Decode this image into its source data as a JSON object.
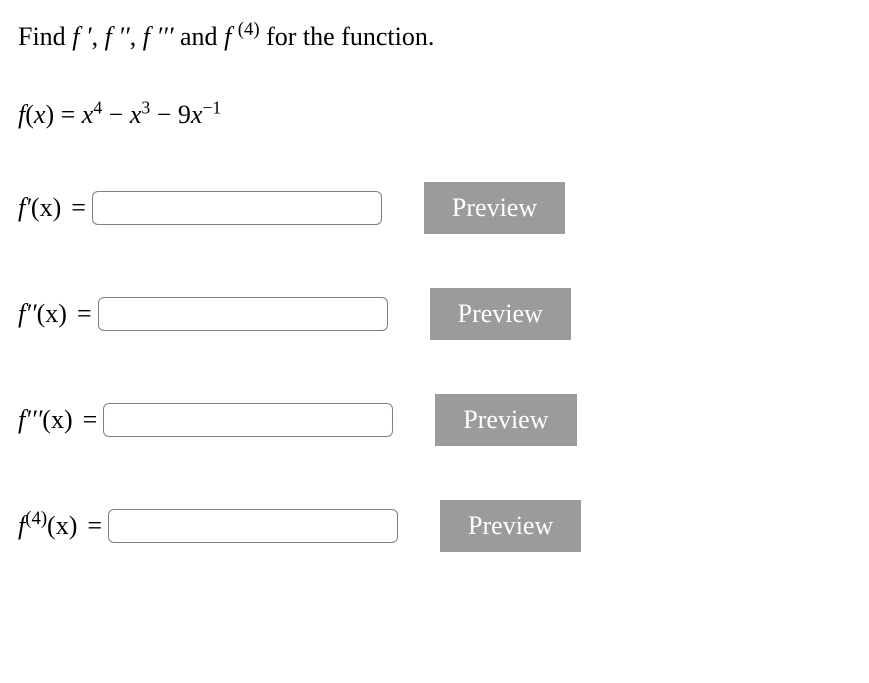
{
  "instruction": {
    "prefix": "Find ",
    "d1": "f ′",
    "sep1": ", ",
    "d2": "f ′′",
    "sep2": ", ",
    "d3": "f ′′′",
    "and_word": " and ",
    "d4_base": "f ",
    "d4_sup": "(4)",
    "suffix": " for the function."
  },
  "function_def": {
    "lhs_f": "f",
    "lhs_open": "(",
    "lhs_x": "x",
    "lhs_close": ") = ",
    "t1_x": "x",
    "t1_exp": "4",
    "m1": " − ",
    "t2_x": "x",
    "t2_exp": "3",
    "m2": " − ",
    "t3_coef": "9",
    "t3_x": "x",
    "t3_exp": "−1"
  },
  "rows": [
    {
      "label_f": "f",
      "label_primes": "′",
      "sup_paren": null,
      "xpart": "(x)",
      "preview": "Preview"
    },
    {
      "label_f": "f",
      "label_primes": "′′",
      "sup_paren": null,
      "xpart": "(x)",
      "preview": "Preview"
    },
    {
      "label_f": "f",
      "label_primes": "′′′",
      "sup_paren": null,
      "xpart": "(x)",
      "preview": "Preview"
    },
    {
      "label_f": "f",
      "label_primes": "",
      "sup_paren": "(4)",
      "xpart": "(x)",
      "preview": "Preview"
    }
  ],
  "eq": "="
}
